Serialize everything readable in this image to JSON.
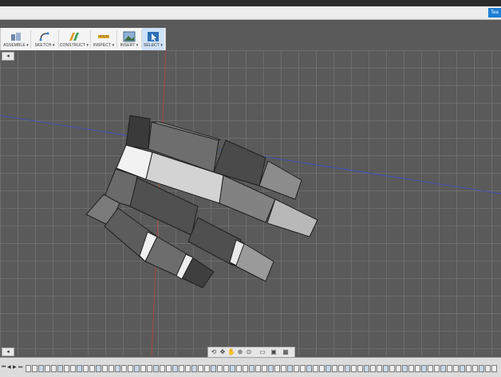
{
  "titlebar": {
    "team_button": "Tea"
  },
  "toolbar": {
    "tools": [
      {
        "label": "ASSEMBLE ▾",
        "icon": "assemble-icon"
      },
      {
        "label": "SKETCH ▾",
        "icon": "sketch-arc-icon"
      },
      {
        "label": "CONSTRUCT ▾",
        "icon": "construct-plane-icon"
      },
      {
        "label": "INSPECT ▾",
        "icon": "inspect-measure-icon"
      },
      {
        "label": "INSERT ▾",
        "icon": "insert-image-icon"
      },
      {
        "label": "SELECT ▾",
        "icon": "select-cursor-icon",
        "selected": true
      }
    ]
  },
  "viewport": {
    "corner_top_label": "◂",
    "corner_bottom_label": "◂",
    "colors": {
      "background": "#5a5a5a",
      "grid": "#8c8c8c",
      "axis_blue": "#3a4fd0",
      "axis_red": "#c24040"
    }
  },
  "navbar": {
    "icons": [
      "orbit-icon",
      "pan-icon",
      "hand-icon",
      "zoom-icon",
      "zoom-window-icon",
      "display-icon",
      "visual-style-icon",
      "grid-icon"
    ]
  },
  "timeline": {
    "controls": [
      "⏮",
      "◀",
      "▶",
      "⏭"
    ]
  }
}
